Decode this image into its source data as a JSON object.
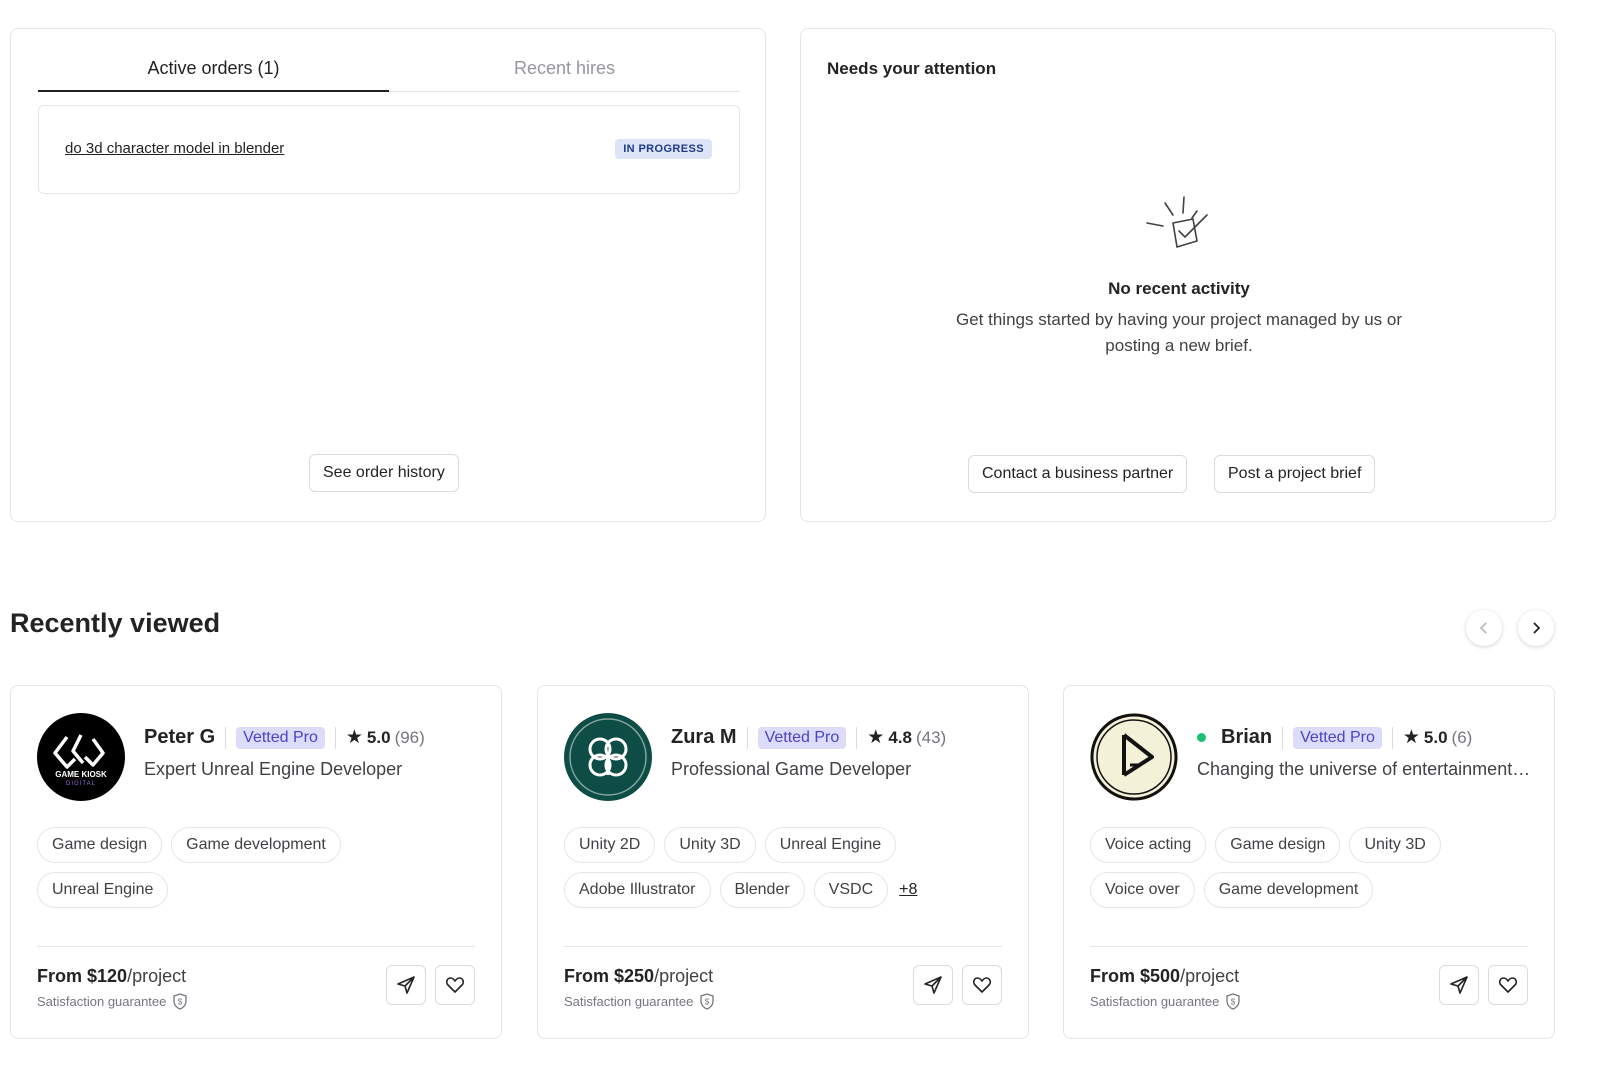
{
  "orders_panel": {
    "tabs": [
      {
        "label": "Active orders (1)",
        "active": true
      },
      {
        "label": "Recent hires",
        "active": false
      }
    ],
    "orders": [
      {
        "title": "do 3d character model in blender",
        "status": "IN PROGRESS"
      }
    ],
    "history_button": "See order history"
  },
  "attention_panel": {
    "title": "Needs your attention",
    "empty_title": "No recent activity",
    "empty_text": "Get things started by having your project managed by us or posting a new brief.",
    "contact_button": "Contact a business partner",
    "post_button": "Post a project brief"
  },
  "recently_viewed": {
    "title": "Recently viewed",
    "cards": [
      {
        "name": "Peter G",
        "badge": "Vetted Pro",
        "rating": "5.0",
        "reviews": "(96)",
        "online": false,
        "tagline": "Expert Unreal Engine Developer",
        "tags": [
          "Game design",
          "Game development",
          "Unreal Engine"
        ],
        "more_tags": "",
        "price_prefix": "From ",
        "price": "$120",
        "price_unit": "/project",
        "guarantee": "Satisfaction guarantee",
        "avatar_text": "GAME KIOSK",
        "avatar_subtext": "DIGITAL"
      },
      {
        "name": "Zura M",
        "badge": "Vetted Pro",
        "rating": "4.8",
        "reviews": "(43)",
        "online": false,
        "tagline": "Professional Game Developer",
        "tags": [
          "Unity 2D",
          "Unity 3D",
          "Unreal Engine",
          "Adobe Illustrator",
          "Blender",
          "VSDC"
        ],
        "more_tags": "+8",
        "price_prefix": "From ",
        "price": "$250",
        "price_unit": "/project",
        "guarantee": "Satisfaction guarantee"
      },
      {
        "name": "Brian",
        "badge": "Vetted Pro",
        "rating": "5.0",
        "reviews": "(6)",
        "online": true,
        "tagline": "Changing the universe of entertainment through games",
        "tags": [
          "Voice acting",
          "Game design",
          "Unity 3D",
          "Voice over",
          "Game development"
        ],
        "more_tags": "",
        "price_prefix": "From ",
        "price": "$500",
        "price_unit": "/project",
        "guarantee": "Satisfaction guarantee"
      }
    ]
  },
  "colors": {
    "vetted_bg": "#dcdcfa",
    "vetted_text": "#4a42c8",
    "status_bg": "#dde4f8",
    "online": "#1dbf73",
    "zura_avatar": "#0e4d45",
    "brian_avatar": "#f3f2d8"
  },
  "icons": [
    "checklist-icon",
    "chevron-left-icon",
    "chevron-right-icon",
    "star-icon",
    "shield-dollar-icon",
    "send-icon",
    "heart-icon",
    "clover-icon"
  ]
}
